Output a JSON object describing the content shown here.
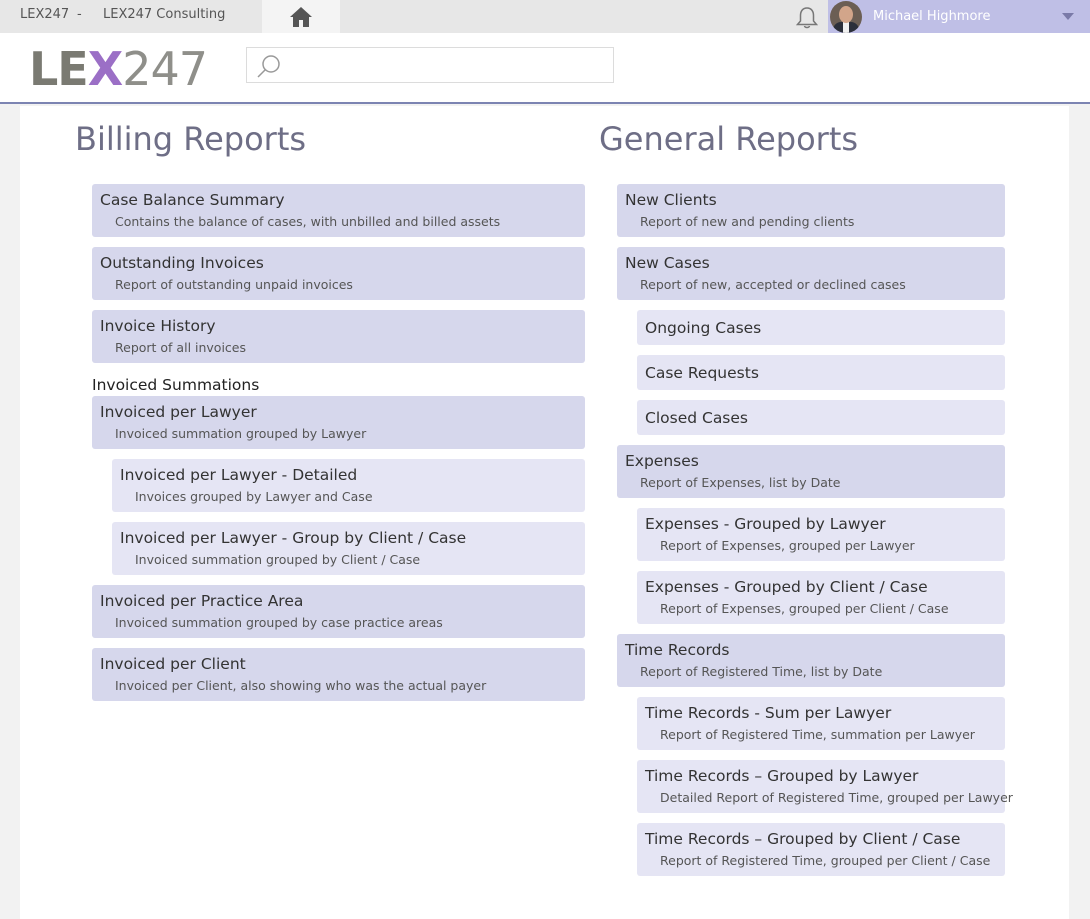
{
  "topbar": {
    "app": "LEX247",
    "separator": "-",
    "company": "LEX247 Consulting",
    "home_icon": "home-icon",
    "bell_icon": "bell-icon",
    "user_name": "Michael Highmore"
  },
  "header": {
    "logo": "LEX247",
    "search_placeholder": ""
  },
  "billing": {
    "title": "Billing Reports",
    "items": [
      {
        "title": "Case Balance Summary",
        "desc": "Contains the balance of cases, with unbilled and billed assets"
      },
      {
        "title": "Outstanding Invoices",
        "desc": "Report of outstanding unpaid invoices"
      },
      {
        "title": "Invoice History",
        "desc": "Report of all invoices"
      }
    ],
    "group_label": "Invoiced Summations",
    "group_items": [
      {
        "title": "Invoiced per Lawyer",
        "desc": "Invoiced summation grouped by Lawyer"
      },
      {
        "title": "Invoiced per Lawyer - Detailed",
        "desc": "Invoices grouped by Lawyer and Case"
      },
      {
        "title": "Invoiced per Lawyer - Group by Client / Case",
        "desc": "Invoiced summation grouped by Client / Case"
      },
      {
        "title": "Invoiced per Practice Area",
        "desc": "Invoiced summation grouped by case practice areas"
      },
      {
        "title": "Invoiced per Client",
        "desc": "Invoiced per Client, also showing who was the actual payer"
      }
    ]
  },
  "general": {
    "title": "General Reports",
    "items": [
      {
        "title": "New Clients",
        "desc": "Report of new and pending clients"
      },
      {
        "title": "New Cases",
        "desc": "Report of new, accepted or declined cases"
      },
      {
        "title": "Ongoing Cases"
      },
      {
        "title": "Case Requests"
      },
      {
        "title": "Closed Cases"
      },
      {
        "title": "Expenses",
        "desc": "Report of Expenses, list by Date"
      },
      {
        "title": "Expenses - Grouped by Lawyer",
        "desc": "Report of Expenses, grouped per Lawyer"
      },
      {
        "title": "Expenses - Grouped by Client / Case",
        "desc": "Report of Expenses, grouped per Client / Case"
      },
      {
        "title": "Time Records",
        "desc": "Report of Registered Time, list by Date"
      },
      {
        "title": "Time Records - Sum per Lawyer",
        "desc": "Report of Registered Time, summation per Lawyer"
      },
      {
        "title": "Time Records – Grouped by Lawyer",
        "desc": "Detailed Report of Registered Time, grouped per Lawyer"
      },
      {
        "title": "Time Records – Grouped by Client / Case",
        "desc": "Report of Registered Time, grouped per Client / Case"
      }
    ]
  }
}
